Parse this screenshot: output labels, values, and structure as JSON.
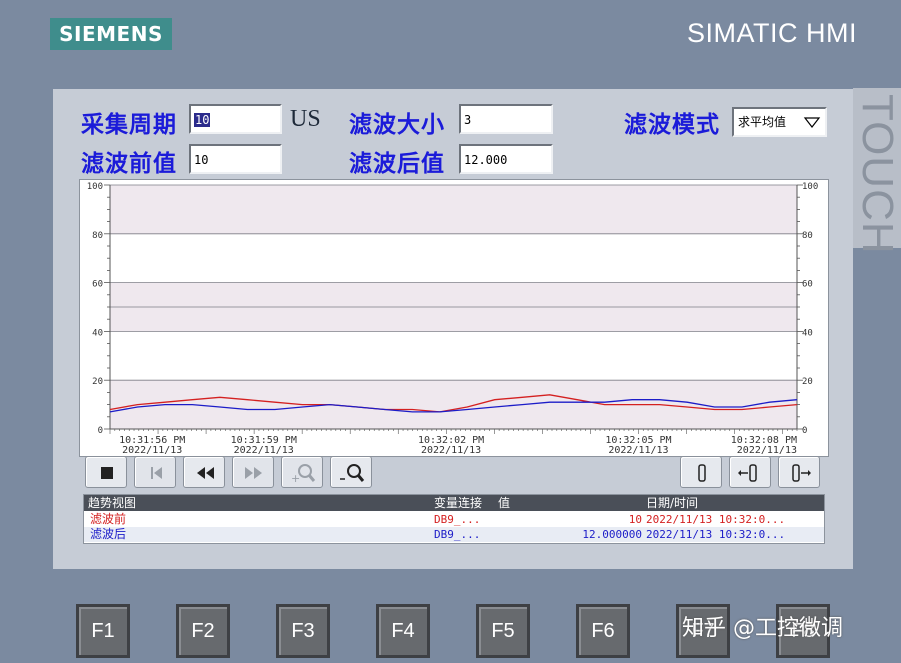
{
  "bezel": {
    "logo": "SIEMENS",
    "brand": "SIMATIC HMI",
    "touch": "TOUCH"
  },
  "form": {
    "sample_period_label": "采集周期",
    "sample_period_value": "10",
    "sample_period_unit": "US",
    "filter_size_label": "滤波大小",
    "filter_size_value": "3",
    "filter_mode_label": "滤波模式",
    "filter_mode_value": "求平均值",
    "before_label": "滤波前值",
    "before_value": "10",
    "after_label": "滤波后值",
    "after_value": "12.000"
  },
  "chart_data": {
    "type": "line",
    "ylim": [
      0,
      100
    ],
    "yticks": [
      "100",
      "80",
      "60",
      "40",
      "20",
      "0"
    ],
    "x_ticks": [
      {
        "time": "10:31:56 PM",
        "date": "2022/11/13"
      },
      {
        "time": "10:31:59 PM",
        "date": "2022/11/13"
      },
      {
        "time": "10:32:02 PM",
        "date": "2022/11/13"
      },
      {
        "time": "10:32:05 PM",
        "date": "2022/11/13"
      },
      {
        "time": "10:32:08 PM",
        "date": "2022/11/13"
      }
    ],
    "x": [
      0,
      0.5,
      1,
      1.5,
      2,
      2.5,
      3,
      3.5,
      4,
      4.5,
      5,
      5.5,
      6,
      6.5,
      7,
      7.5,
      8,
      8.5,
      9,
      9.5,
      10,
      10.5,
      11,
      11.5,
      12,
      12.5
    ],
    "series": [
      {
        "name": "滤波前",
        "color": "#d42020",
        "values": [
          8,
          10,
          11,
          12,
          13,
          12,
          11,
          10,
          10,
          9,
          8,
          8,
          7,
          9,
          12,
          13,
          14,
          12,
          10,
          10,
          10,
          9,
          8,
          8,
          9,
          10
        ]
      },
      {
        "name": "滤波后",
        "color": "#1c1cc8",
        "values": [
          7,
          9,
          10,
          10,
          9,
          8,
          8,
          9,
          10,
          9,
          8,
          7,
          7,
          8,
          9,
          10,
          11,
          11,
          11,
          12,
          12,
          11,
          9,
          9,
          11,
          12
        ]
      }
    ],
    "grid": true
  },
  "toolbar": {
    "buttons": [
      "stop",
      "first",
      "rewind",
      "forward",
      "zoom-in",
      "zoom-out",
      "ruler",
      "ruler-back",
      "ruler-forward"
    ]
  },
  "table": {
    "headers": [
      "趋势视图",
      "变量连接",
      "值",
      "日期/时间"
    ],
    "rows": [
      {
        "name": "滤波前",
        "link": "DB9_...",
        "value": "10",
        "datetime": "2022/11/13  10:32:0...",
        "color": "#d42020"
      },
      {
        "name": "滤波后",
        "link": "DB9_...",
        "value": "12.000000",
        "datetime": "2022/11/13  10:32:0...",
        "color": "#1c1cc8"
      }
    ]
  },
  "fkeys": [
    "F1",
    "F2",
    "F3",
    "F4",
    "F5",
    "F6",
    "F7",
    "F8"
  ],
  "watermark": "知乎 @工控微调"
}
